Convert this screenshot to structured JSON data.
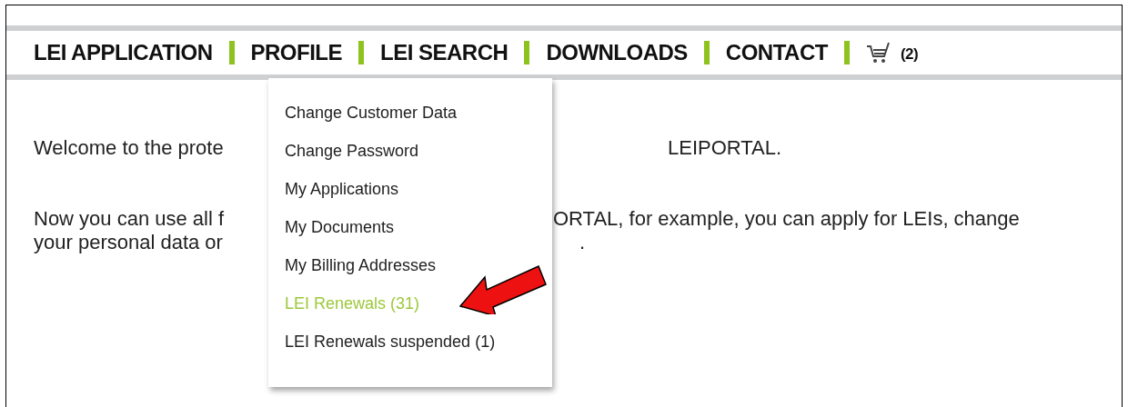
{
  "nav": {
    "items": [
      {
        "label": "LEI APPLICATION"
      },
      {
        "label": "PROFILE"
      },
      {
        "label": "LEI SEARCH"
      },
      {
        "label": "DOWNLOADS"
      },
      {
        "label": "CONTACT"
      }
    ],
    "cart_count": "(2)"
  },
  "content": {
    "lines": [
      {
        "left": "Welcome to the prote",
        "right": "LEIPORTAL."
      },
      {
        "left": "Now you can use all f",
        "right": "ORTAL, for example, you can apply for LEIs, change"
      },
      {
        "left": "your personal data or",
        "right": "."
      }
    ]
  },
  "profile_menu": {
    "items": [
      {
        "label": "Change Customer Data",
        "selected": false
      },
      {
        "label": "Change Password",
        "selected": false
      },
      {
        "label": "My Applications",
        "selected": false
      },
      {
        "label": "My Documents",
        "selected": false
      },
      {
        "label": "My Billing Addresses",
        "selected": false
      },
      {
        "label": "LEI Renewals (31)",
        "selected": true
      },
      {
        "label": "LEI Renewals suspended (1)",
        "selected": false
      }
    ]
  }
}
